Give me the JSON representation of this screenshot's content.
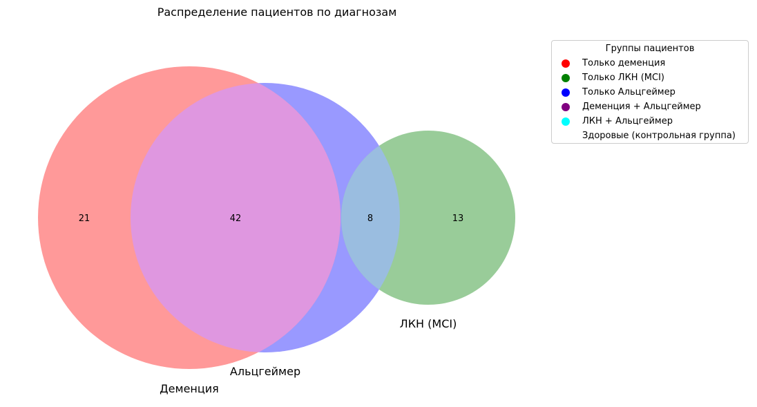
{
  "chart_data": {
    "type": "venn",
    "title": "Распределение пациентов по диагнозам",
    "sets": [
      {
        "name": "Деменция",
        "color": "#ff9999"
      },
      {
        "name": "Альцгеймер",
        "color": "#9999ff"
      },
      {
        "name": "ЛКН (MCI)",
        "color": "#99cc99"
      }
    ],
    "regions": [
      {
        "sets": [
          "Деменция"
        ],
        "value": 21
      },
      {
        "sets": [
          "Деменция",
          "Альцгеймер"
        ],
        "value": 42
      },
      {
        "sets": [
          "Альцгеймер",
          "ЛКН (MCI)"
        ],
        "value": 8
      },
      {
        "sets": [
          "ЛКН (MCI)"
        ],
        "value": 13
      }
    ],
    "overlap_colors": {
      "dementia_alzheimer": "#df97e0",
      "alzheimer_mci": "#9abde0"
    }
  },
  "legend": {
    "title": "Группы пациентов",
    "items": [
      {
        "label": "Только деменция",
        "color": "#ff0000"
      },
      {
        "label": "Только ЛКН (MCI)",
        "color": "#008000"
      },
      {
        "label": "Только Альцгеймер",
        "color": "#0000ff"
      },
      {
        "label": "Деменция + Альцгеймер",
        "color": "#800080"
      },
      {
        "label": "ЛКН + Альцгеймер",
        "color": "#00ffff"
      },
      {
        "label": "Здоровые (контрольная группа)",
        "color": "#ffffff"
      }
    ]
  }
}
